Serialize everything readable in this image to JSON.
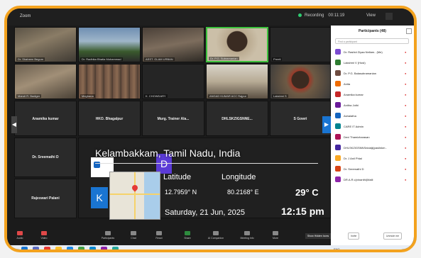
{
  "window": {
    "title": "Zoom",
    "recording": "Recording",
    "timer": "00:11:19",
    "view": "View"
  },
  "tiles": [
    {
      "name": "Dr. Shaheen Begum",
      "kind": "room"
    },
    {
      "name": "Dr. Radhika Bhatia Mohammad",
      "kind": "outdoor"
    },
    {
      "name": "ASST. GLAM URBAN",
      "kind": "room"
    },
    {
      "name": "Dr. P.G. Subramanian",
      "kind": "speaker"
    },
    {
      "name": "Preeti",
      "kind": "dark"
    },
    {
      "name": "Maruti R. Badiger",
      "kind": "room"
    },
    {
      "name": "Meghana",
      "kind": "crowd"
    },
    {
      "name": "K. CHOWDARY",
      "kind": "dark"
    },
    {
      "name": "ANGAD KUMAR ACC Rajpur",
      "kind": "room"
    },
    {
      "name": "Lakshmi S",
      "kind": "person"
    },
    {
      "name": "Anamika kumar",
      "kind": "label"
    },
    {
      "name": "HKO. Bhagalpur",
      "kind": "label"
    },
    {
      "name": "Murg. Trainer Ala...",
      "kind": "label"
    },
    {
      "name": "DHLSKZIGSNNE...",
      "kind": "label"
    },
    {
      "name": "S Gowri",
      "kind": "label"
    },
    {
      "name": "Dr. Sreemathi D",
      "kind": "label"
    },
    {
      "name": "Rajeswari Palani",
      "kind": "label"
    }
  ],
  "overlay": {
    "location": "Kelambakkam, Tamil Nadu, India",
    "latitude_label": "Latitude",
    "longitude_label": "Longitude",
    "latitude": "12.7959° N",
    "longitude": "80.2168° E",
    "temperature": "29° C",
    "date": "Saturday, 21 Jun, 2025",
    "time": "12:15 pm"
  },
  "toolbar": {
    "items": [
      "Audio",
      "Video",
      "Participants",
      "Chat",
      "React",
      "Share",
      "AI Companion",
      "Meeting info",
      "More"
    ],
    "end_hint": "Show Hidden Icons"
  },
  "panel": {
    "title": "Participants (48)",
    "search_placeholder": "Find a participant",
    "participants": [
      {
        "name": "Dr. Rashid Ziyaa Nellam.. (Me)",
        "color": "#7b4bd1"
      },
      {
        "name": "Lakshmi V (Host)",
        "color": "#2e7d32"
      },
      {
        "name": "Dr. P.G. Balasubramanian",
        "color": "#6d4c41"
      },
      {
        "name": "Anita",
        "color": "#ef6c00"
      },
      {
        "name": "Anamika kumar",
        "color": "#c62828"
      },
      {
        "name": "Anitha Jothi",
        "color": "#6a1b9a"
      },
      {
        "name": "Ashalatha",
        "color": "#1565c0"
      },
      {
        "name": "CARE IT Admin",
        "color": "#00838f"
      },
      {
        "name": "Devi Thamizharasan",
        "color": "#ad1457"
      },
      {
        "name": "DHLSKZIGSNNSnidaiji(pasilnkm..",
        "color": "#4527a0"
      },
      {
        "name": "Dr. J Anil Phial",
        "color": "#f9a825"
      },
      {
        "name": "Dr. Sreemathi D",
        "color": "#d84315"
      },
      {
        "name": "DR.A.R.c(vinanthi)Malli",
        "color": "#8e24aa"
      }
    ],
    "invite_label": "Invite",
    "unmute_label": "Unmute me"
  },
  "taskbar": {
    "system": "ENG"
  },
  "colors": {
    "frame": "#f3a21e",
    "speaker_border": "#3cc13c",
    "share": "#2e8b3e"
  }
}
